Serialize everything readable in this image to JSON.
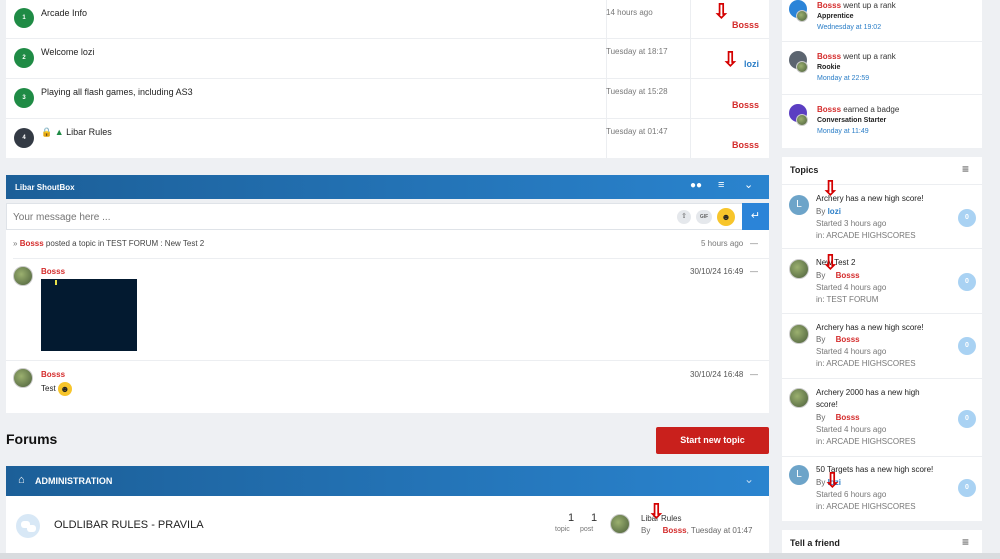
{
  "ranked": [
    {
      "n": "1",
      "title": "Arcade Info",
      "time": "14 hours ago",
      "user": "Bosss",
      "user_color": "red"
    },
    {
      "n": "2",
      "title": "Welcome lozi",
      "time": "Tuesday at 18:17",
      "user": "lozi",
      "user_color": "blue"
    },
    {
      "n": "3",
      "title": "Playing all flash games, including AS3",
      "time": "Tuesday at 15:28",
      "user": "Bosss",
      "user_color": "red"
    },
    {
      "n": "4",
      "title": "Libar Rules",
      "time": "Tuesday at 01:47",
      "user": "Bosss",
      "user_color": "red"
    }
  ],
  "shoutbox": {
    "title": "Libar ShoutBox",
    "placeholder": "Your message here ...",
    "gif_label": "GIF",
    "notice": {
      "prefix": "»",
      "user": "Bosss",
      "text": " posted a topic in TEST FORUM : New Test 2",
      "time": "5 hours ago",
      "dash": "—"
    },
    "messages": [
      {
        "user": "Bosss",
        "time": "30/10/24 16:49",
        "dash": "—"
      },
      {
        "user": "Bosss",
        "time": "30/10/24 16:48",
        "dash": "—",
        "text": "Test"
      }
    ]
  },
  "forums": {
    "title": "Forums",
    "start_button": "Start new topic",
    "admin_title": "ADMINISTRATION",
    "row": {
      "name": "OLDLIBAR RULES - PRAVILA",
      "topics": "1",
      "topics_label": "topic",
      "posts": "1",
      "posts_label": "post",
      "last_title": "Libar Rules",
      "by_label": "By",
      "last_user": "Bosss",
      "last_time": ", Tuesday at 01:47"
    }
  },
  "activity": [
    {
      "user": "Bosss",
      "action": " went up a rank",
      "rank": "Apprentice",
      "time": "Wednesday at 19:02"
    },
    {
      "user": "Bosss",
      "action": " went up a rank",
      "rank": "Rookie",
      "time": "Monday at 22:59"
    },
    {
      "user": "Bosss",
      "action": " earned a badge",
      "rank": "Conversation Starter",
      "time": "Monday at 11:49"
    }
  ],
  "topics_widget": {
    "title": "Topics",
    "by_label": "By",
    "items": [
      {
        "title": "Archery has a new high score!",
        "user": "lozi",
        "user_color": "blue",
        "started": "Started 3 hours ago",
        "in": "in: ARCADE HIGHSCORES",
        "count": "0",
        "avatar": "L"
      },
      {
        "title": "New Test 2",
        "user": "Bosss",
        "user_color": "red",
        "started": "Started 4 hours ago",
        "in": "in: TEST FORUM",
        "count": "0",
        "avatar": ""
      },
      {
        "title": "Archery has a new high score!",
        "user": "Bosss",
        "user_color": "red",
        "started": "Started 4 hours ago",
        "in": "in: ARCADE HIGHSCORES",
        "count": "0",
        "avatar": ""
      },
      {
        "title": "Archery 2000 has a new high score!",
        "user": "Bosss",
        "user_color": "red",
        "started": "Started 4 hours ago",
        "in": "in: ARCADE HIGHSCORES",
        "count": "0",
        "avatar": ""
      },
      {
        "title": "50 Targets has a new high score!",
        "user": "lozi",
        "user_color": "blue",
        "started": "Started 6 hours ago",
        "in": "in: ARCADE HIGHSCORES",
        "count": "0",
        "avatar": "L"
      }
    ]
  },
  "tell_friend": {
    "title": "Tell a friend"
  }
}
